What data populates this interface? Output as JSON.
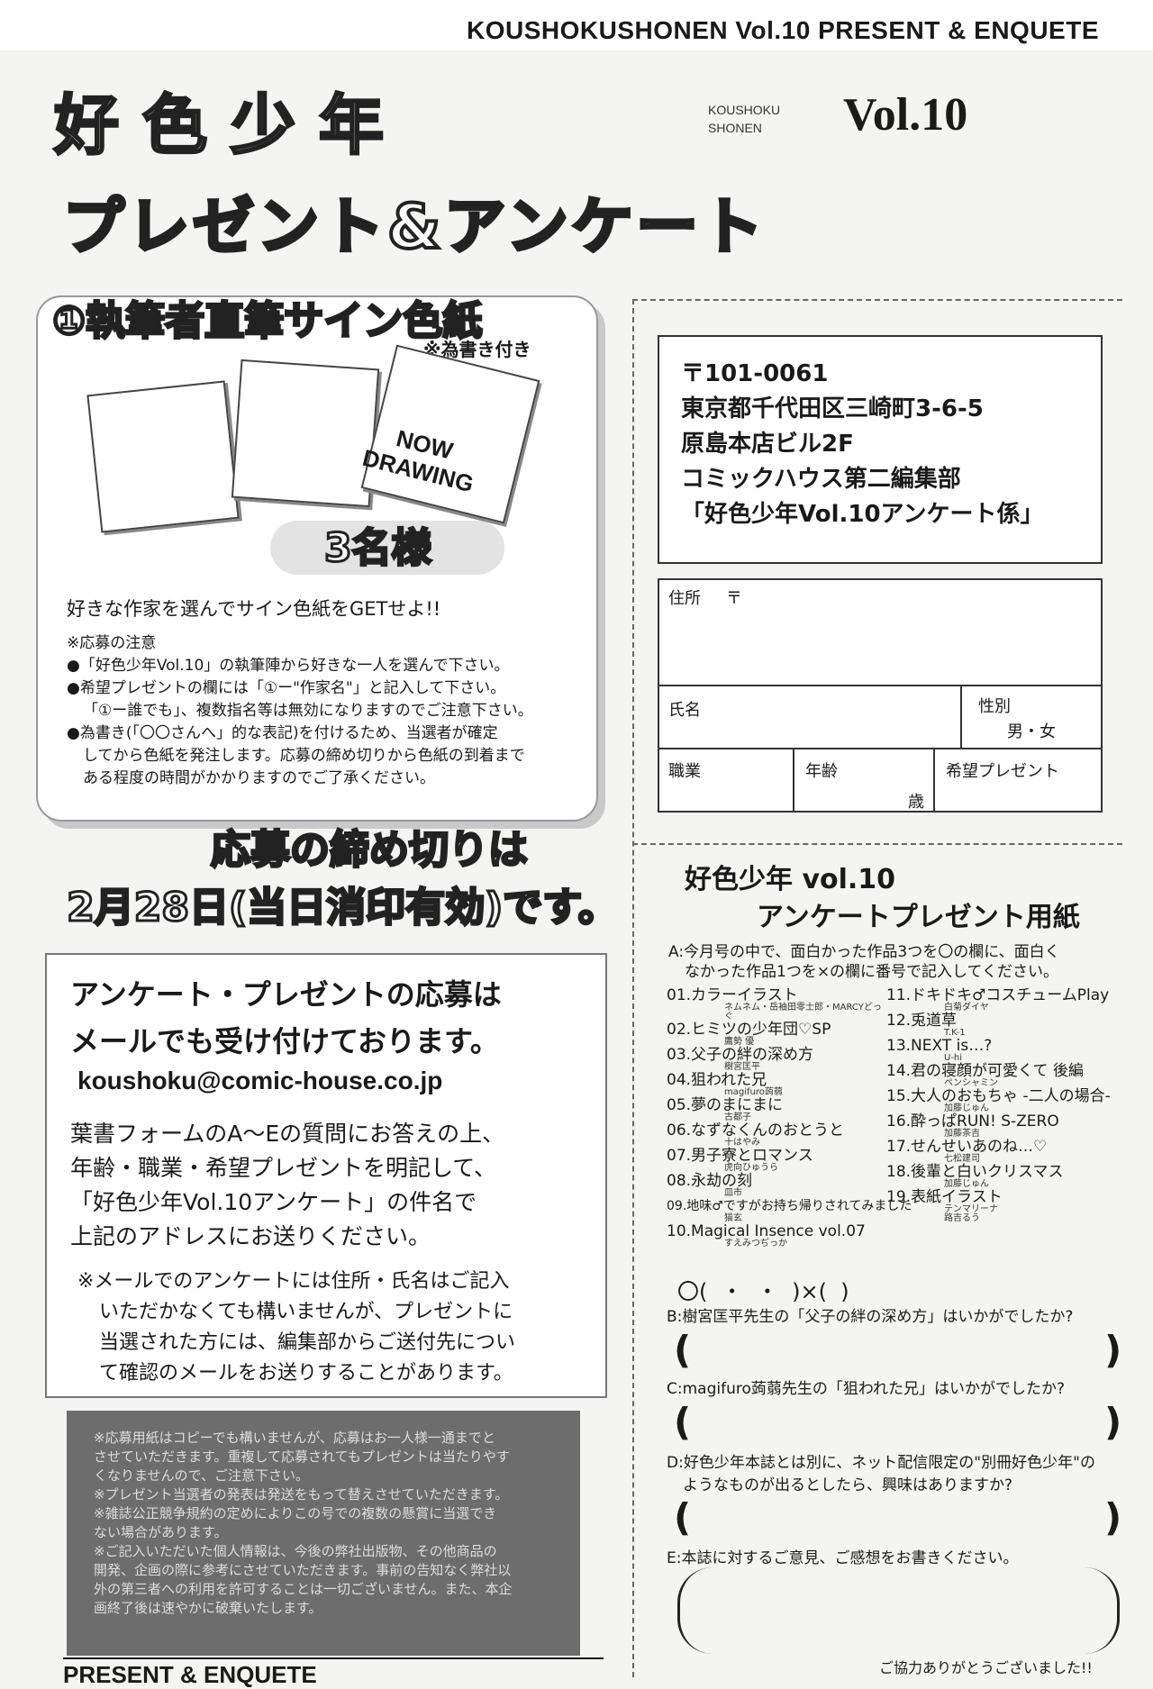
{
  "header": {
    "banner": "KOUSHOKUSHONEN Vol.10 PRESENT & ENQUETE"
  },
  "title": {
    "jp": "好色少年",
    "romaji_1": "KOUSHOKU",
    "romaji_2": "SHONEN",
    "vol": "Vol.10",
    "sub": "プレゼント&アンケート"
  },
  "present": {
    "heading": "①執筆者直筆サイン色紙",
    "note": "※為書き付き",
    "now_1": "NOW",
    "now_2": "DRAWING",
    "winners": "3名様",
    "lead": "好きな作家を選んでサイン色紙をGETせよ!!",
    "notes": [
      "※応募の注意",
      "●「好色少年Vol.10」の執筆陣から好きな一人を選んで下さい。",
      "●希望プレゼントの欄には「①ー\"作家名\"」と記入して下さい。",
      "「①ー誰でも」、複数指名等は無効になりますのでご注意下さい。",
      "●為書き(「〇〇さんへ」的な表記)を付けるため、当選者が確定",
      "してから色紙を発注します。応募の締め切りから色紙の到着まで",
      "ある程度の時間がかかりますのでご了承ください。"
    ]
  },
  "deadline": {
    "line1": "応募の締め切りは",
    "line2": "2月28日(当日消印有効)です。"
  },
  "mail": {
    "heading_1": "アンケート・プレゼントの応募は",
    "heading_2": "メールでも受け付けております。",
    "address": "koushoku@comic-house.co.jp",
    "body": [
      "葉書フォームのA〜Eの質問にお答えの上、",
      "年齢・職業・希望プレゼントを明記して、",
      "「好色少年Vol.10アンケート」の件名で",
      "上記のアドレスにお送りください。"
    ],
    "note": [
      "※メールでのアンケートには住所・氏名はご記入",
      "いただかなくても構いませんが、プレゼントに",
      "当選された方には、編集部からご送付先につい",
      "て確認のメールをお送りすることがあります。"
    ]
  },
  "fineprint": [
    "※応募用紙はコピーでも構いませんが、応募はお一人様一通までと",
    "させていただきます。重複して応募されてもプレゼントは当たりやす",
    "くなりませんので、ご注意下さい。",
    "※プレゼント当選者の発表は発送をもって替えさせていただきます。",
    "※雑誌公正競争規約の定めによりこの号での複数の懸賞に当選でき",
    "ない場合があります。",
    "※ご記入いただいた個人情報は、今後の弊社出版物、その他商品の",
    "開発、企画の際に参考にさせていただきます。事前の告知なく弊社以",
    "外の第三者への利用を許可することは一切ございません。また、本企",
    "画終了後は速やかに破棄いたします。"
  ],
  "footer": {
    "banner": "PRESENT & ENQUETE"
  },
  "postal": {
    "zip": "〒101-0061",
    "line1": "東京都千代田区三崎町3-6-5",
    "line2": "原島本店ビル2F",
    "line3": "コミックハウス第二編集部",
    "line4": "「好色少年Vol.10アンケート係」"
  },
  "form": {
    "address": "住所",
    "zip_mark": "〒",
    "name": "氏名",
    "sex": "性別",
    "sex_options": "男・女",
    "job": "職業",
    "age": "年齢",
    "age_unit": "歳",
    "wish": "希望プレゼント"
  },
  "survey": {
    "title_1": "好色少年  vol.10",
    "title_2": "アンケートプレゼント用紙",
    "qa_1": "A:今月号の中で、面白かった作品3つを〇の欄に、面白く",
    "qa_2": "なかった作品1つを×の欄に番号で記入してください。",
    "works_left": [
      {
        "t": "01.カラーイラスト",
        "a": "ネムネム・岳袖田零士郎・MARCYどっぐ"
      },
      {
        "t": "02.ヒミツの少年団♡SP",
        "a": "鷹勢 優"
      },
      {
        "t": "03.父子の絆の深め方",
        "a": "樹宮匡平"
      },
      {
        "t": "04.狙われた兄",
        "a": "magifuro蒟蒻"
      },
      {
        "t": "05.夢のまにまに",
        "a": "古都子"
      },
      {
        "t": "06.なずなくんのおとうと",
        "a": "十はやみ"
      },
      {
        "t": "07.男子寮とロマンス",
        "a": "虎向ひゅうら"
      },
      {
        "t": "08.永劫の刻",
        "a": "皿市"
      },
      {
        "t": "09.地味♂ですがお持ち帰りされてみました",
        "a": "猫玄"
      },
      {
        "t": "10.Magical Insence vol.07",
        "a": "すえみつぢっか"
      }
    ],
    "works_right": [
      {
        "t": "11.ドキドキ♂コスチュームPlay",
        "a": "白菊ダイヤ"
      },
      {
        "t": "12.兎道草",
        "a": "T.K-1"
      },
      {
        "t": "13.NEXT is…?",
        "a": "U-hi"
      },
      {
        "t": "14.君の寝顔が可愛くて 後編",
        "a": "ペンシャミン"
      },
      {
        "t": "15.大人のおもちゃ -二人の場合-",
        "a": "加藤じゅん"
      },
      {
        "t": "16.酔っぱRUN! S-ZERO",
        "a": "加藤茶吉"
      },
      {
        "t": "17.せんせいあのね…♡",
        "a": "七松建司"
      },
      {
        "t": "18.後輩と白いクリスマス",
        "a": "加藤じゅん"
      },
      {
        "t": "19.表紙イラスト",
        "a": "テンマリーナ"
      },
      {
        "t": "",
        "a": "路吉るう"
      }
    ],
    "answer_row": "〇(  ・  ・  )×(  )",
    "qb": "B:樹宮匡平先生の「父子の絆の深め方」はいかがでしたか?",
    "qc": "C:magifuro蒟蒻先生の「狙われた兄」はいかがでしたか?",
    "qd_1": "D:好色少年本誌とは別に、ネット配信限定の\"別冊好色少年\"の",
    "qd_2": "ようなものが出るとしたら、興味はありますか?",
    "qe": "E:本誌に対するご意見、ご感想をお書きください。",
    "thanks": "ご協力ありがとうございました!!"
  }
}
